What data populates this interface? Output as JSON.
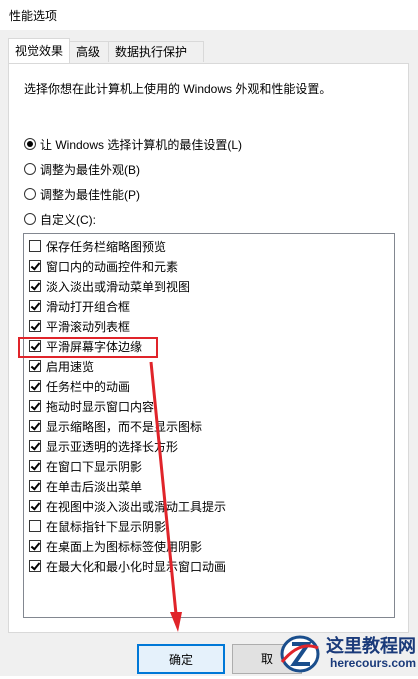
{
  "window": {
    "title": "性能选项"
  },
  "tabs": [
    {
      "label": "视觉效果",
      "active": true
    },
    {
      "label": "高级",
      "active": false
    },
    {
      "label": "数据执行保护",
      "active": false
    }
  ],
  "description": "选择你想在此计算机上使用的 Windows 外观和性能设置。",
  "radios": [
    {
      "label": "让 Windows 选择计算机的最佳设置(L)",
      "selected": true
    },
    {
      "label": "调整为最佳外观(B)",
      "selected": false
    },
    {
      "label": "调整为最佳性能(P)",
      "selected": false
    },
    {
      "label": "自定义(C):",
      "selected": false
    }
  ],
  "options": [
    {
      "label": "保存任务栏缩略图预览",
      "checked": false
    },
    {
      "label": "窗口内的动画控件和元素",
      "checked": true
    },
    {
      "label": "淡入淡出或滑动菜单到视图",
      "checked": true
    },
    {
      "label": "滑动打开组合框",
      "checked": true
    },
    {
      "label": "平滑滚动列表框",
      "checked": true
    },
    {
      "label": "平滑屏幕字体边缘",
      "checked": true
    },
    {
      "label": "启用速览",
      "checked": true
    },
    {
      "label": "任务栏中的动画",
      "checked": true
    },
    {
      "label": "拖动时显示窗口内容",
      "checked": true
    },
    {
      "label": "显示缩略图，而不是显示图标",
      "checked": true
    },
    {
      "label": "显示亚透明的选择长方形",
      "checked": true
    },
    {
      "label": "在窗口下显示阴影",
      "checked": true
    },
    {
      "label": "在单击后淡出菜单",
      "checked": true
    },
    {
      "label": "在视图中淡入淡出或滑动工具提示",
      "checked": true
    },
    {
      "label": "在鼠标指针下显示阴影",
      "checked": false
    },
    {
      "label": "在桌面上为图标标签使用阴影",
      "checked": true
    },
    {
      "label": "在最大化和最小化时显示窗口动画",
      "checked": true
    }
  ],
  "buttons": {
    "ok": "确定",
    "cancel": "取"
  },
  "watermark": {
    "site_name": "这里教程网",
    "site_url": "herecours.com",
    "accent": "#e0242a"
  },
  "colors": {
    "annotation": "#e0242a",
    "focus": "#0078d7"
  }
}
